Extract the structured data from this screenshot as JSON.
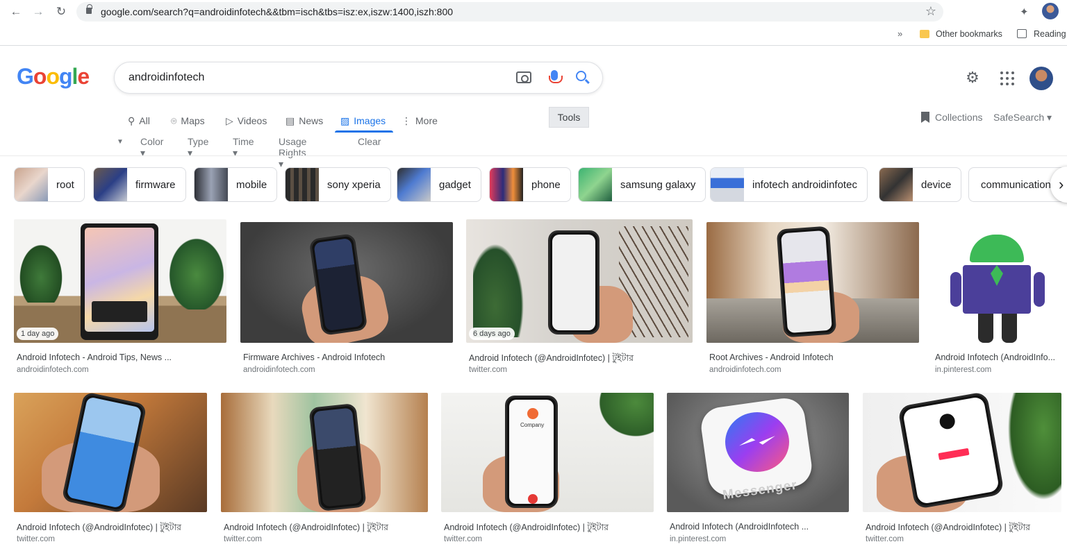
{
  "browser": {
    "url": "google.com/search?q=androidinfotech&&tbm=isch&tbs=isz:ex,iszw:1400,iszh:800",
    "bookmarks_overflow": "»",
    "other_bookmarks": "Other bookmarks",
    "reading_list": "Reading"
  },
  "search": {
    "logo_letters": [
      "G",
      "o",
      "o",
      "g",
      "l",
      "e"
    ],
    "query": "androidinfotech"
  },
  "tabs": [
    {
      "label": "All",
      "icon": "search-icon"
    },
    {
      "label": "Maps",
      "icon": "pin-icon"
    },
    {
      "label": "Videos",
      "icon": "play-icon"
    },
    {
      "label": "News",
      "icon": "news-icon"
    },
    {
      "label": "Images",
      "icon": "image-icon",
      "active": true
    },
    {
      "label": "More",
      "icon": "more-vert-icon"
    }
  ],
  "tools_label": "Tools",
  "collections_label": "Collections",
  "safesearch_label": "SafeSearch ▾",
  "filters": {
    "color": "Color ▾",
    "type": "Type ▾",
    "time": "Time ▾",
    "usage": "Usage Rights ▾",
    "clear": "Clear"
  },
  "chips": [
    "root",
    "firmware",
    "mobile",
    "sony xperia",
    "gadget",
    "phone",
    "samsung galaxy",
    "infotech androidinfotec",
    "device",
    "communication"
  ],
  "results": [
    {
      "title": "Android Infotech - Android Tips, News ...",
      "domain": "androidinfotech.com",
      "badge": "1 day ago"
    },
    {
      "title": "Firmware Archives - Android Infotech",
      "domain": "androidinfotech.com"
    },
    {
      "title": "Android Infotech (@AndroidInfotec) | টুইটার",
      "domain": "twitter.com",
      "badge": "6 days ago"
    },
    {
      "title": "Root Archives - Android Infotech",
      "domain": "androidinfotech.com"
    },
    {
      "title": "Android Infotech (AndroidInfo...",
      "domain": "in.pinterest.com"
    },
    {
      "title": "Android Infotech (@AndroidInfotec) | টুইটার",
      "domain": "twitter.com"
    },
    {
      "title": "Android Infotech (@AndroidInfotec) | টুইটার",
      "domain": "twitter.com"
    },
    {
      "title": "Android Infotech (@AndroidInfotec) | টুইটার",
      "domain": "twitter.com"
    },
    {
      "title": "Android Infotech (AndroidInfotech ...",
      "domain": "in.pinterest.com"
    },
    {
      "title": "Android Infotech (@AndroidInfotec) | টুইটার",
      "domain": "twitter.com"
    }
  ],
  "image_text": {
    "messenger": "Messenger",
    "company": "Company"
  }
}
